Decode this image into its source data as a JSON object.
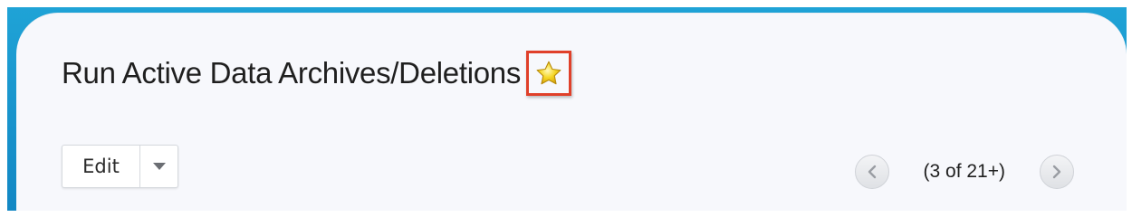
{
  "record": {
    "title": "Run Active Data Archives/Deletions",
    "favorite_icon": "star-icon",
    "favorite_color": "#f5d623"
  },
  "actions": {
    "edit_label": "Edit",
    "dropdown_icon": "caret-down-icon"
  },
  "pagination": {
    "prev_icon": "chevron-left-icon",
    "next_icon": "chevron-right-icon",
    "count_text": "(3 of 21+)"
  },
  "colors": {
    "frame_accent": "#1287c4",
    "highlight_box": "#e0402a"
  }
}
